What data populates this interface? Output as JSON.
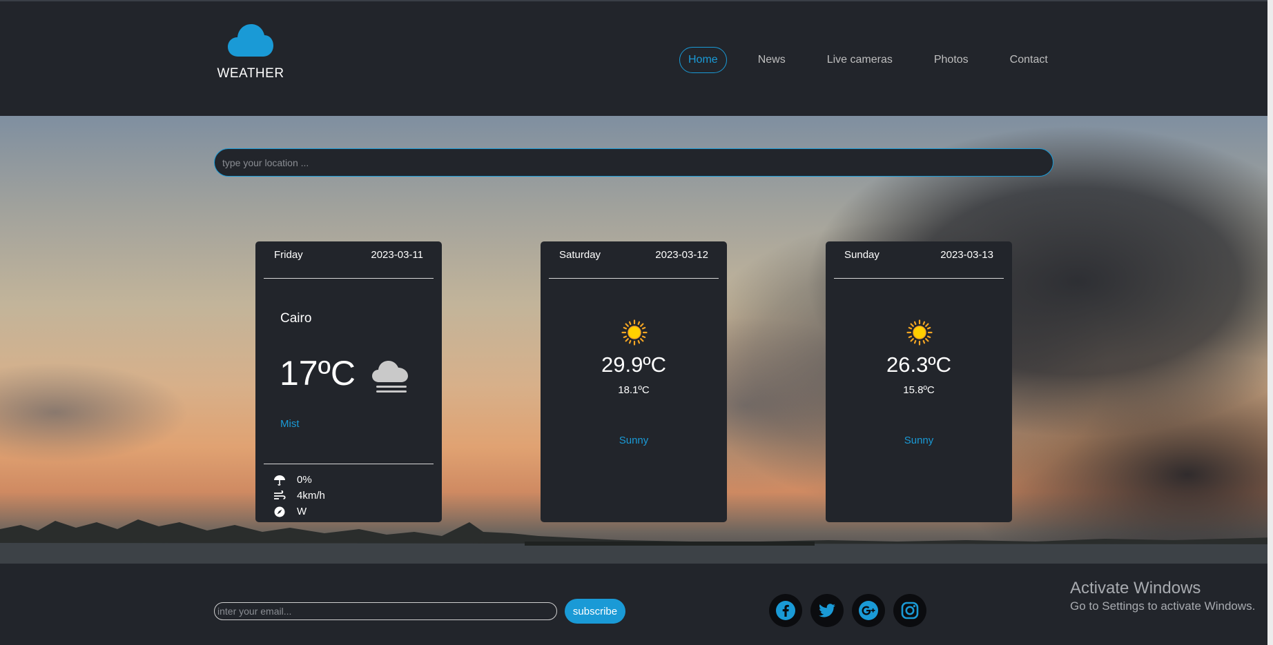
{
  "header": {
    "logo_text": "WEATHER",
    "nav": [
      {
        "label": "Home",
        "active": true
      },
      {
        "label": "News",
        "active": false
      },
      {
        "label": "Live cameras",
        "active": false
      },
      {
        "label": "Photos",
        "active": false
      },
      {
        "label": "Contact",
        "active": false
      }
    ]
  },
  "search": {
    "placeholder": "type your location ...",
    "value": ""
  },
  "today": {
    "day": "Friday",
    "date": "2023-03-11",
    "city": "Cairo",
    "temperature": "17ºC",
    "condition": "Mist",
    "icon": "mist-cloud-icon",
    "stats": {
      "rain": "0%",
      "wind_speed": "4km/h",
      "wind_direction": "W"
    }
  },
  "forecast": [
    {
      "day": "Saturday",
      "date": "2023-03-12",
      "max_temp": "29.9ºC",
      "min_temp": "18.1ºC",
      "condition": "Sunny",
      "icon": "sun-icon"
    },
    {
      "day": "Sunday",
      "date": "2023-03-13",
      "max_temp": "26.3ºC",
      "min_temp": "15.8ºC",
      "condition": "Sunny",
      "icon": "sun-icon"
    }
  ],
  "footer": {
    "email_placeholder": "inter your email...",
    "email_value": "",
    "subscribe_label": "subscribe",
    "social": [
      "facebook",
      "twitter",
      "google-plus",
      "instagram"
    ]
  },
  "windows_watermark": {
    "title": "Activate Windows",
    "subtitle": "Go to Settings to activate Windows."
  },
  "colors": {
    "accent": "#1a9ad6",
    "panel": "#22252b",
    "text": "#ffffff",
    "muted": "#bfbfbf"
  }
}
